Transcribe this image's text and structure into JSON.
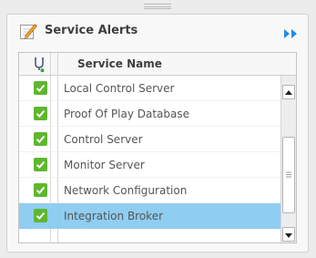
{
  "panel": {
    "title": "Service Alerts"
  },
  "grid": {
    "column_header": "Service Name",
    "rows": [
      {
        "label": "Local Control Server",
        "checked": true,
        "selected": false
      },
      {
        "label": "Proof Of Play Database",
        "checked": true,
        "selected": false
      },
      {
        "label": "Control Server",
        "checked": true,
        "selected": false
      },
      {
        "label": "Monitor Server",
        "checked": true,
        "selected": false
      },
      {
        "label": "Network Configuration",
        "checked": true,
        "selected": false
      },
      {
        "label": "Integration Broker",
        "checked": true,
        "selected": true
      }
    ]
  },
  "icons": {
    "edit": "edit-pencil-icon",
    "expand": "double-arrow-right-icon",
    "header": "stethoscope-icon",
    "checkbox": "checkbox-checked-icon"
  },
  "colors": {
    "selected_row": "#8fcdf1",
    "checkbox": "#5eb72e",
    "expand_arrow": "#1f8ce6"
  }
}
